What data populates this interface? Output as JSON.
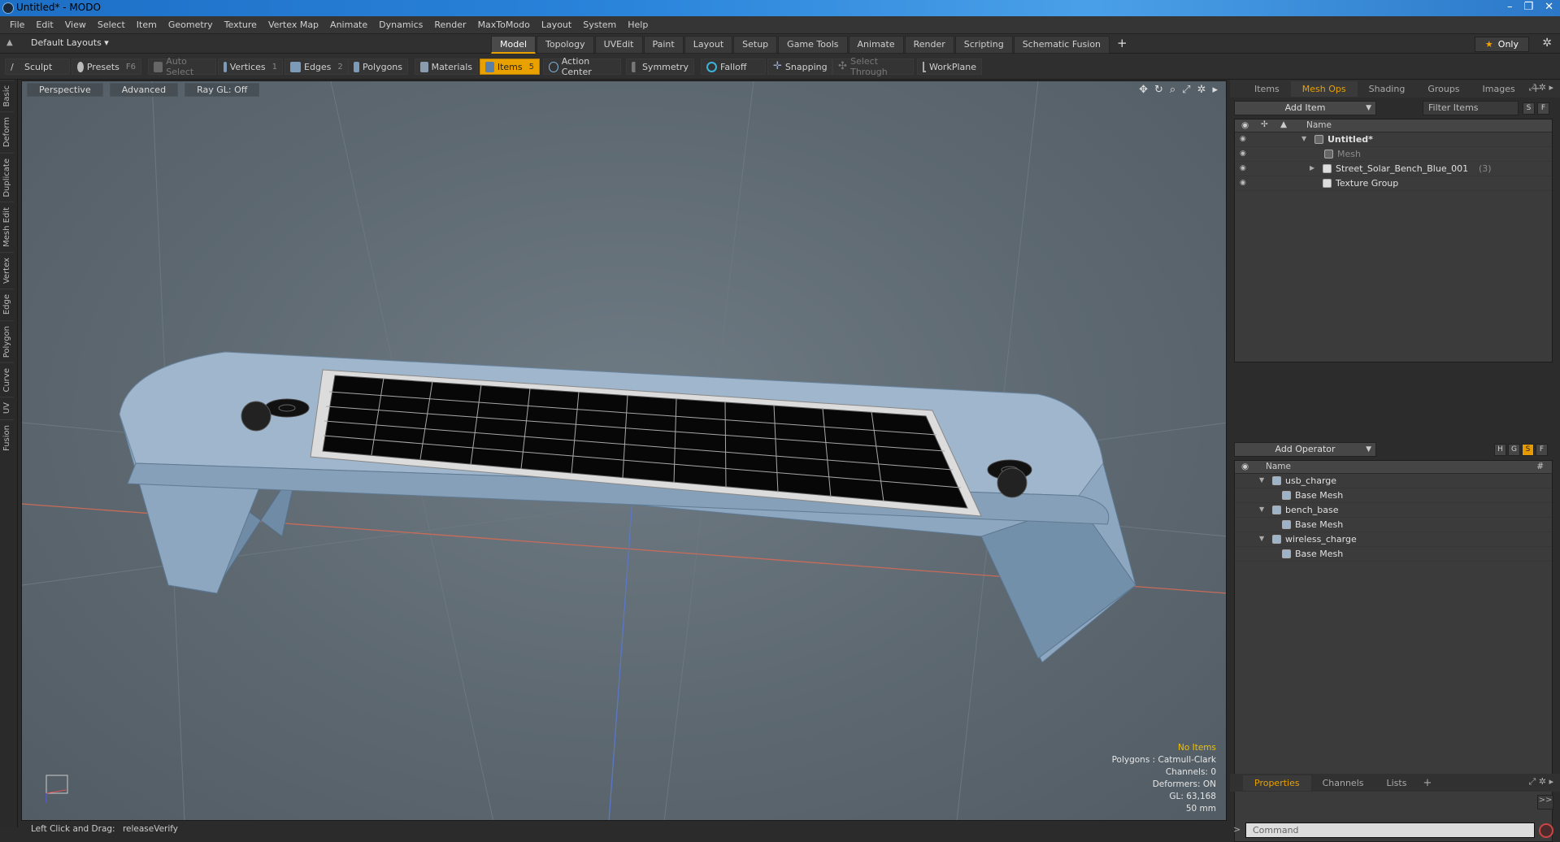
{
  "window": {
    "title": "Untitled* - MODO",
    "controls": [
      "–",
      "❐",
      "✕"
    ]
  },
  "menu": [
    "File",
    "Edit",
    "View",
    "Select",
    "Item",
    "Geometry",
    "Texture",
    "Vertex Map",
    "Animate",
    "Dynamics",
    "Render",
    "MaxToModo",
    "Layout",
    "System",
    "Help"
  ],
  "layout": {
    "name": "Default Layouts ▾",
    "tabs": [
      "Model",
      "Topology",
      "UVEdit",
      "Paint",
      "Layout",
      "Setup",
      "Game Tools",
      "Animate",
      "Render",
      "Scripting",
      "Schematic Fusion"
    ],
    "active_tab": "Model",
    "add_tab": "+",
    "only_label": "Only"
  },
  "toolbar": {
    "sculpt": "Sculpt",
    "presets": "Presets",
    "presets_key": "F6",
    "auto_select": "Auto Select",
    "vertices": "Vertices",
    "vertices_key": "1",
    "edges": "Edges",
    "edges_key": "2",
    "polygons": "Polygons",
    "materials": "Materials",
    "items": "Items",
    "items_key": "5",
    "action_center": "Action Center",
    "symmetry": "Symmetry",
    "falloff": "Falloff",
    "snapping": "Snapping",
    "select_through": "Select Through",
    "workplane": "WorkPlane"
  },
  "left_tabs": [
    "Basic",
    "Deform",
    "Duplicate",
    "Mesh Edit",
    "Vertex",
    "Edge",
    "Polygon",
    "Curve",
    "UV",
    "Fusion"
  ],
  "viewport": {
    "view_mode": "Perspective",
    "shading": "Advanced",
    "raygl": "Ray GL: Off",
    "hud": {
      "no_items": "No Items",
      "polygons": "Polygons : Catmull-Clark",
      "channels": "Channels: 0",
      "deformers": "Deformers: ON",
      "gl": "GL: 63,168",
      "scale": "50 mm"
    }
  },
  "status": {
    "hint": "Left Click and Drag:",
    "action": "releaseVerify"
  },
  "items_panel": {
    "tabs": [
      "Items",
      "Mesh Ops",
      "Shading",
      "Groups",
      "Images"
    ],
    "active_tab": "Mesh Ops",
    "add_item": "Add Item",
    "filter_placeholder": "Filter Items",
    "btn_s": "S",
    "btn_f": "F",
    "column_name": "Name",
    "tree": {
      "root": "Untitled*",
      "mesh": "Mesh",
      "bench": "Street_Solar_Bench_Blue_001",
      "bench_count": "(3)",
      "texture_group": "Texture Group"
    }
  },
  "meshops_panel": {
    "add_operator": "Add Operator",
    "btn_h": "H",
    "btn_g": "G",
    "btn_s": "S",
    "btn_f": "F",
    "column_name": "Name",
    "column_hash": "#",
    "ops": [
      {
        "name": "usb_charge",
        "child": "Base Mesh"
      },
      {
        "name": "bench_base",
        "child": "Base Mesh"
      },
      {
        "name": "wireless_charge",
        "child": "Base Mesh"
      }
    ]
  },
  "properties_panel": {
    "tabs": [
      "Properties",
      "Channels",
      "Lists"
    ],
    "active_tab": "Properties",
    "expand": ">>",
    "command_placeholder": "Command"
  }
}
